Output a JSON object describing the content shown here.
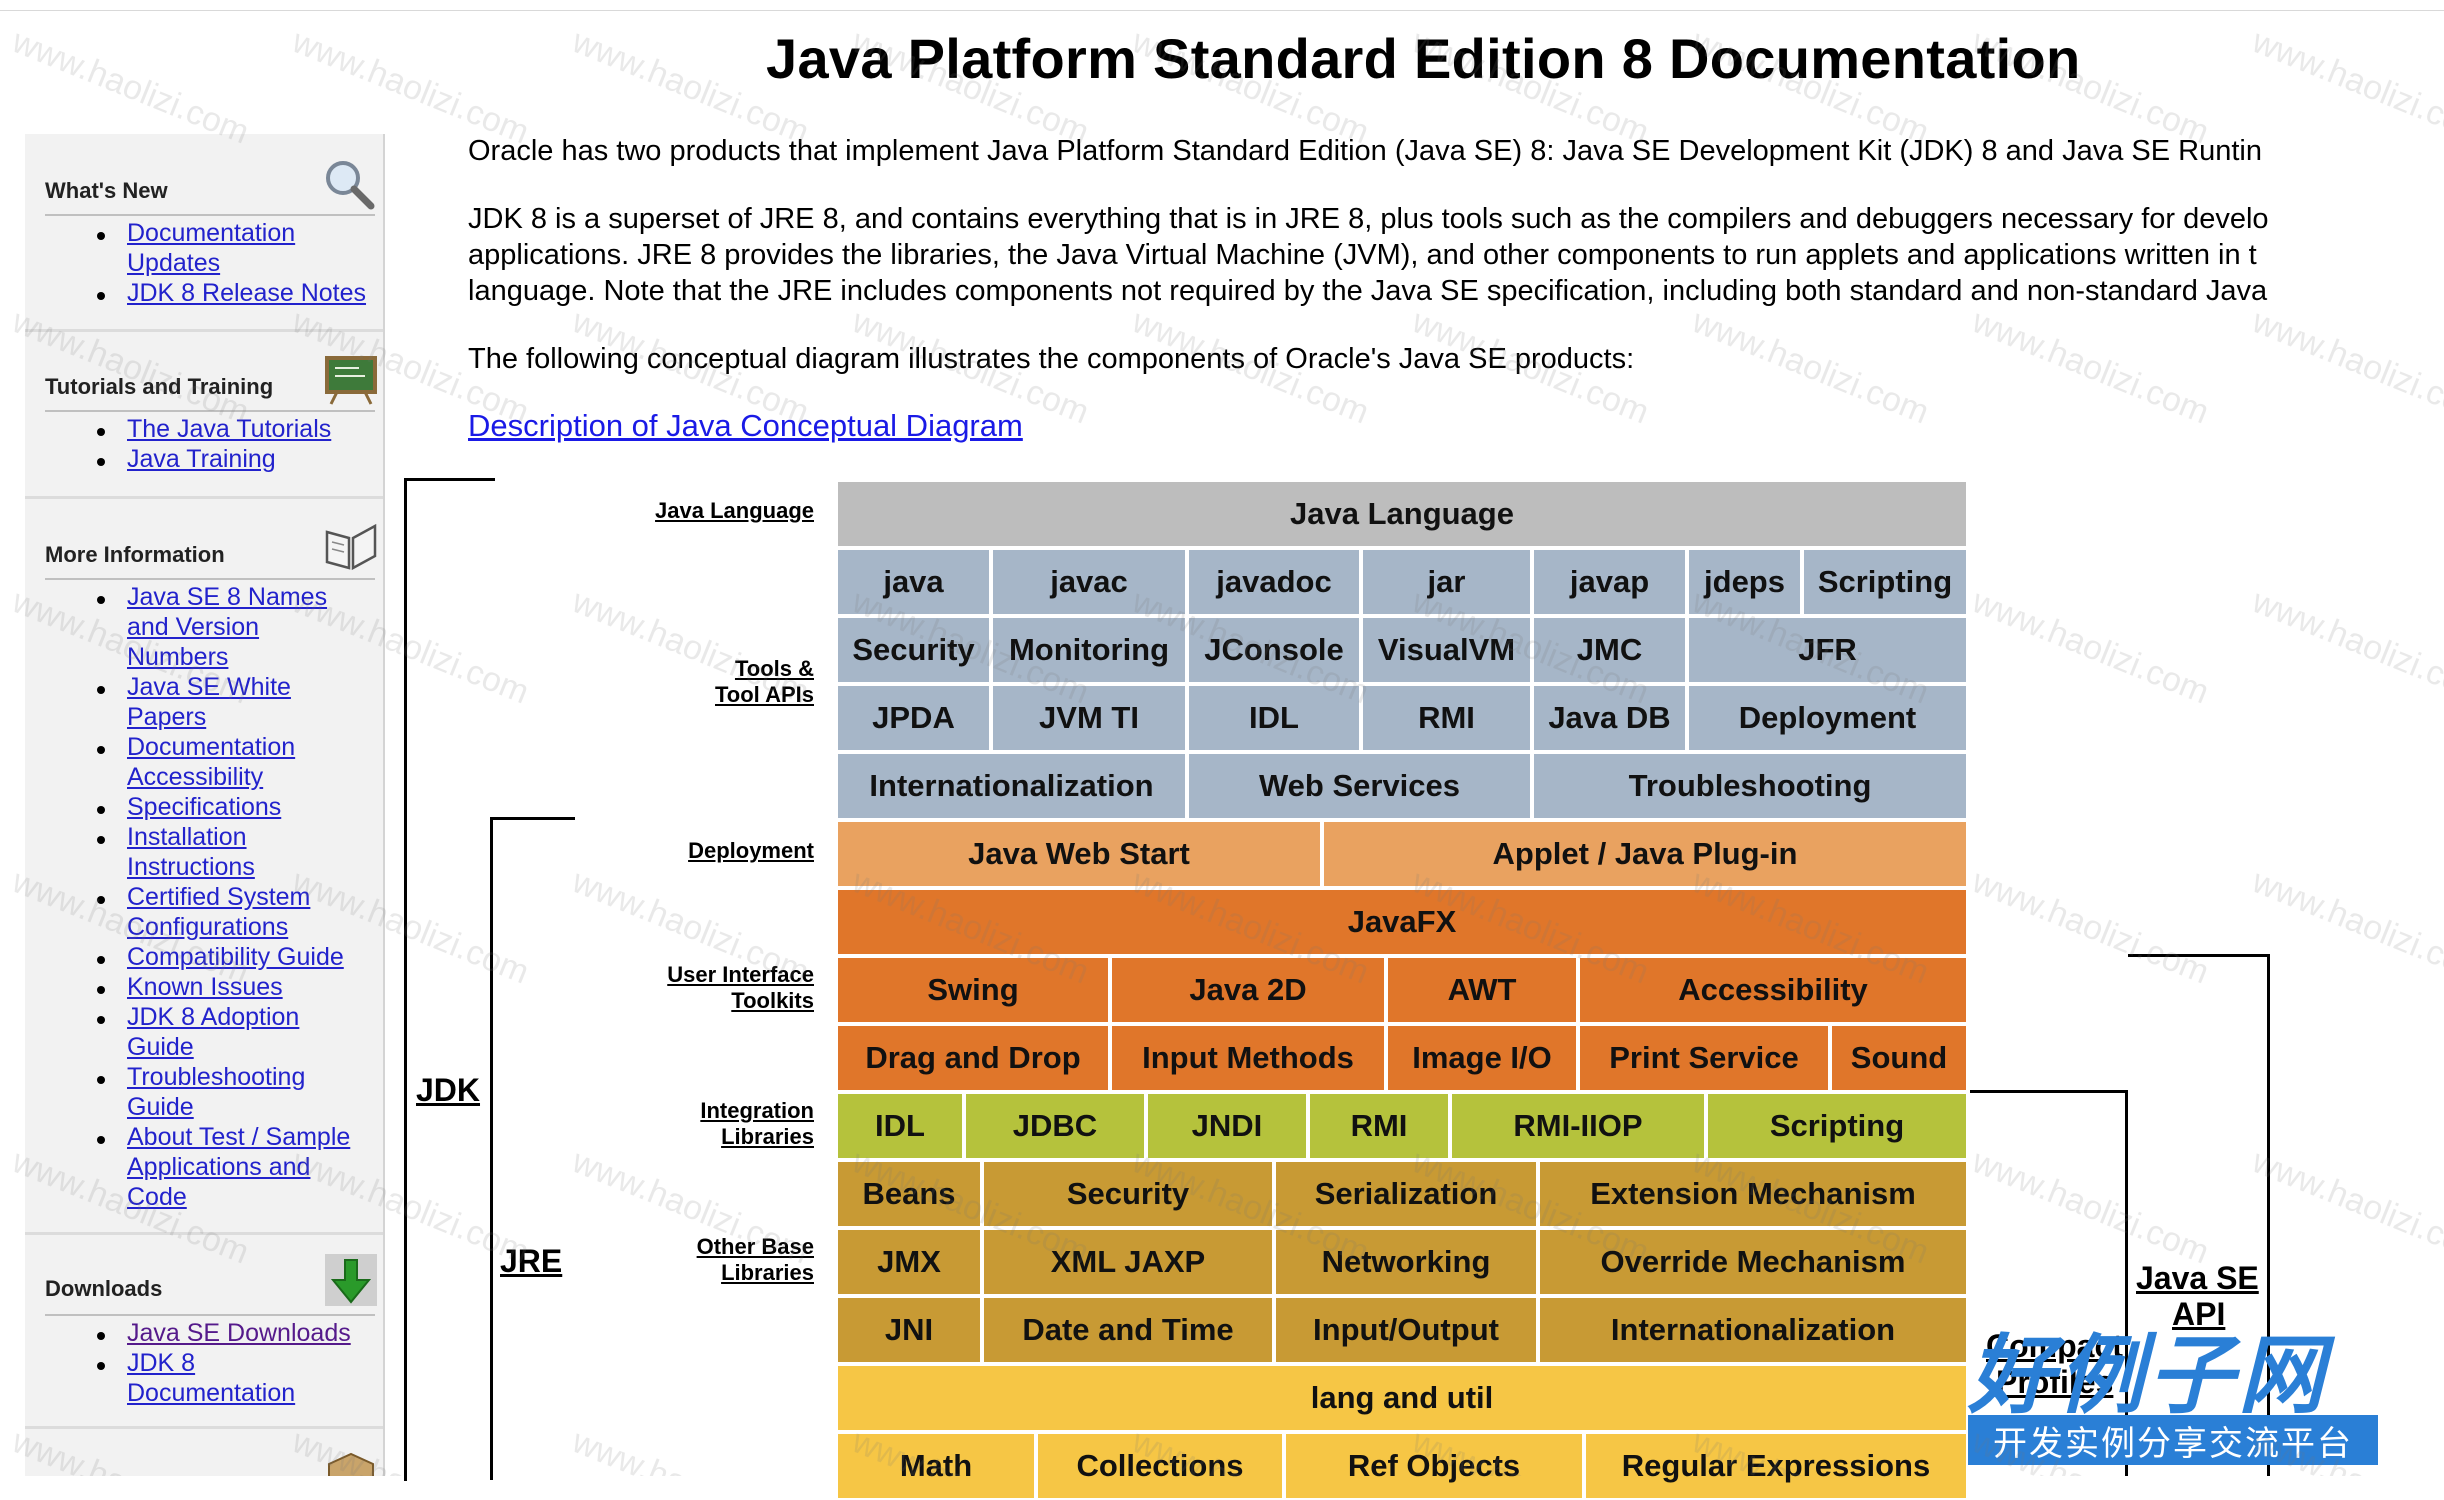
{
  "page": {
    "title": "Java Platform Standard Edition 8 Documentation",
    "paragraph1": "Oracle has two products that implement Java Platform Standard Edition (Java SE) 8: Java SE Development Kit (JDK) 8 and Java SE Runtin",
    "paragraph2_line1": "JDK 8 is a superset of JRE 8, and contains everything that is in JRE 8, plus tools such as the compilers and debuggers necessary for develo",
    "paragraph2_line2": "applications. JRE 8 provides the libraries, the Java Virtual Machine (JVM), and other components to run applets and applications written in t",
    "paragraph2_line3": "language. Note that the JRE includes components not required by the Java SE specification, including both standard and non-standard Java",
    "paragraph3": "The following conceptual diagram illustrates the components of Oracle's Java SE products:",
    "diagram_link": "Description of Java Conceptual Diagram"
  },
  "sidebar": {
    "whats_new": {
      "heading": "What's New",
      "icon": "magnifier-icon",
      "links": [
        "Documentation",
        "Updates",
        "JDK 8 Release Notes"
      ]
    },
    "tutorials": {
      "heading": "Tutorials and Training",
      "icon": "chalkboard-icon",
      "links": [
        "The Java Tutorials",
        "Java Training"
      ]
    },
    "more_info": {
      "heading": "More Information",
      "icon": "book-icon",
      "links": [
        "Java SE 8 Names",
        "and Version",
        "Numbers",
        "Java SE White",
        "Papers",
        "Documentation",
        "Accessibility",
        "Specifications",
        "Installation",
        "Instructions",
        "Certified System",
        "Configurations",
        "Compatibility Guide",
        "Known Issues",
        "JDK 8 Adoption",
        "Guide",
        "Troubleshooting",
        "Guide",
        "About Test / Sample",
        "Applications and",
        "Code"
      ]
    },
    "downloads": {
      "heading": "Downloads",
      "icon": "download-arrow-icon",
      "links": [
        "Java SE Downloads",
        "JDK 8",
        "Documentation"
      ]
    }
  },
  "diagram": {
    "row_labels": {
      "java_language": "Java Language",
      "tools_1": "Tools &",
      "tools_2": "Tool APIs",
      "deployment": "Deployment",
      "ui_1": "User Interface",
      "ui_2": "Toolkits",
      "integration_1": "Integration",
      "integration_2": "Libraries",
      "other_base_1": "Other Base",
      "other_base_2": "Libraries"
    },
    "group_labels": {
      "jdk": "JDK",
      "jre": "JRE",
      "java_se_api_1": "Java SE",
      "java_se_api_2": "API",
      "compact_1": "Compact",
      "compact_2": "Profiles"
    },
    "rows": {
      "r0": [
        "Java Language"
      ],
      "r1": [
        "java",
        "javac",
        "javadoc",
        "jar",
        "javap",
        "jdeps",
        "Scripting"
      ],
      "r2": [
        "Security",
        "Monitoring",
        "JConsole",
        "VisualVM",
        "JMC",
        "JFR"
      ],
      "r3": [
        "JPDA",
        "JVM TI",
        "IDL",
        "RMI",
        "Java DB",
        "Deployment"
      ],
      "r4": [
        "Internationalization",
        "Web Services",
        "Troubleshooting"
      ],
      "r5": [
        "Java Web Start",
        "Applet / Java Plug-in"
      ],
      "r6": [
        "JavaFX"
      ],
      "r7": [
        "Swing",
        "Java 2D",
        "AWT",
        "Accessibility"
      ],
      "r8": [
        "Drag and Drop",
        "Input Methods",
        "Image I/O",
        "Print Service",
        "Sound"
      ],
      "r9": [
        "IDL",
        "JDBC",
        "JNDI",
        "RMI",
        "RMI-IIOP",
        "Scripting"
      ],
      "r10": [
        "Beans",
        "Security",
        "Serialization",
        "Extension Mechanism"
      ],
      "r11": [
        "JMX",
        "XML JAXP",
        "Networking",
        "Override Mechanism"
      ],
      "r12": [
        "JNI",
        "Date and Time",
        "Input/Output",
        "Internationalization"
      ],
      "r13": [
        "lang and util"
      ],
      "r14": [
        "Math",
        "Collections",
        "Ref Objects",
        "Regular Expressions"
      ]
    },
    "colors": {
      "language": "#bdbdbd",
      "tools": "#a6b6c8",
      "deployment": "#e9a260",
      "ui": "#e0762a",
      "integration": "#b5c23c",
      "other_base": "#c89a34",
      "lang_util": "#f6c645"
    }
  },
  "watermark": {
    "brand": "好例子网",
    "tagline": "开发实例分享交流平台",
    "repeat_text": "www.haolizi.com"
  }
}
